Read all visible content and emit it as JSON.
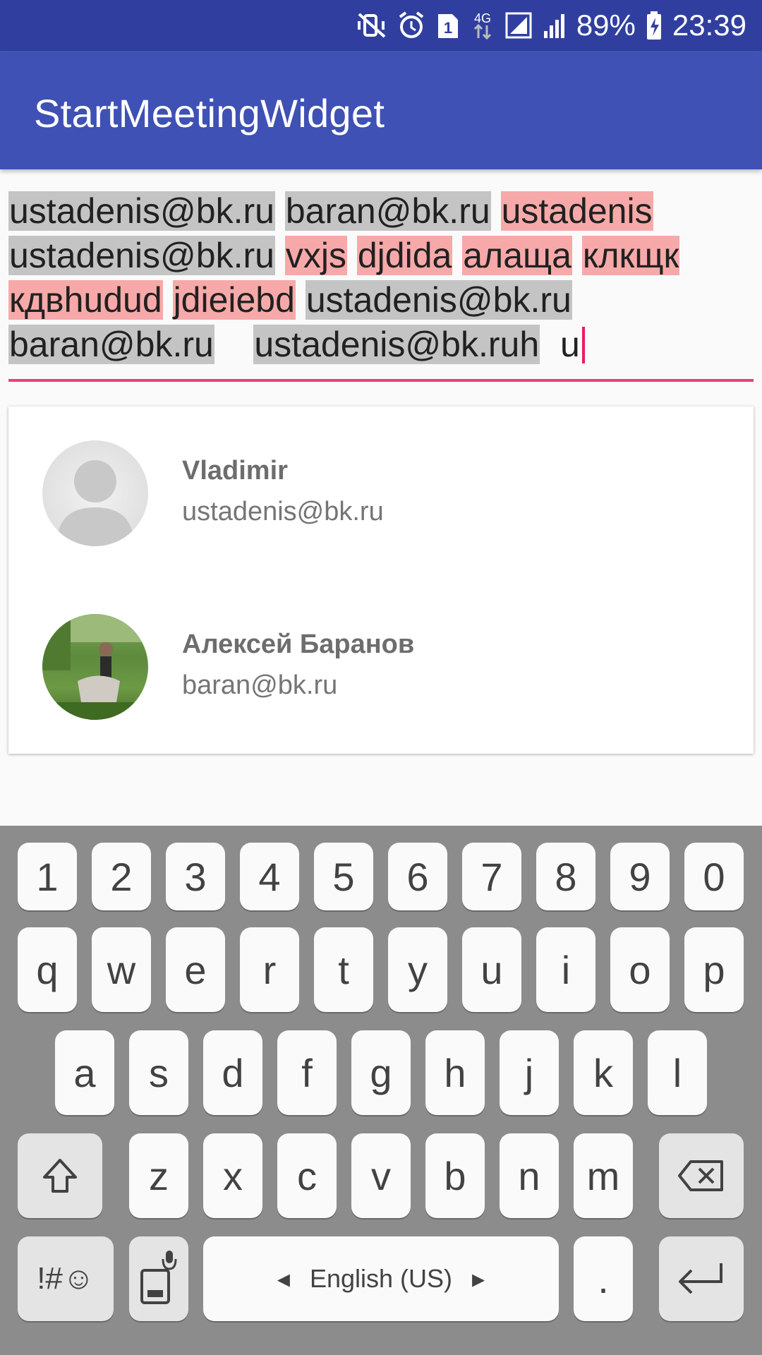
{
  "status_bar": {
    "battery_percent": "89%",
    "time": "23:39",
    "sim_slot": "1",
    "network_type": "4G",
    "icons": [
      "mute-vibrate-icon",
      "alarm-icon",
      "sim-icon",
      "data-arrows-icon",
      "signal-icon",
      "signal-icon",
      "battery-charging-icon"
    ]
  },
  "app_bar": {
    "title": "StartMeetingWidget"
  },
  "recipients": {
    "chips": [
      {
        "text": "ustadenis@bk.ru",
        "state": "valid"
      },
      {
        "text": "baran@bk.ru",
        "state": "valid"
      },
      {
        "text": "ustadenis",
        "state": "invalid"
      },
      {
        "text": "ustadenis@bk.ru",
        "state": "valid"
      },
      {
        "text": "vxjs",
        "state": "invalid"
      },
      {
        "text": "djdida",
        "state": "invalid"
      },
      {
        "text": "алаща",
        "state": "invalid"
      },
      {
        "text": "клкщк",
        "state": "invalid"
      },
      {
        "text": "кдвhudud",
        "state": "invalid"
      },
      {
        "text": "jdieiebd",
        "state": "invalid"
      },
      {
        "text": "ustadenis@bk.ru",
        "state": "valid"
      },
      {
        "text": "baran@bk.ru",
        "state": "valid"
      },
      {
        "text": "ustadenis@bk.ruh",
        "state": "valid"
      }
    ],
    "typed_text": "u",
    "colors": {
      "valid": "#c4c4c4",
      "invalid": "#f7a9a9",
      "underline": "#ec407a"
    }
  },
  "suggestions": [
    {
      "name": "Vladimir",
      "email": "ustadenis@bk.ru",
      "avatar": "default-avatar-icon"
    },
    {
      "name": "Алексей Баранов",
      "email": "baran@bk.ru",
      "avatar": "photo"
    }
  ],
  "keyboard": {
    "row_numbers": [
      "1",
      "2",
      "3",
      "4",
      "5",
      "6",
      "7",
      "8",
      "9",
      "0"
    ],
    "row_1": [
      "q",
      "w",
      "e",
      "r",
      "t",
      "y",
      "u",
      "i",
      "o",
      "p"
    ],
    "row_2": [
      "a",
      "s",
      "d",
      "f",
      "g",
      "h",
      "j",
      "k",
      "l"
    ],
    "row_3": [
      "z",
      "x",
      "c",
      "v",
      "b",
      "n",
      "m"
    ],
    "symbols_label": "!#☺",
    "space_label": "English (US)",
    "period_label": ".",
    "icons": {
      "shift": "shift-icon",
      "backspace": "backspace-icon",
      "enter": "enter-icon",
      "voice": "mic-icon"
    }
  },
  "colors": {
    "status_bar": "#303f9f",
    "app_bar": "#3f51b5",
    "keyboard_bg": "#8c8c8c"
  }
}
